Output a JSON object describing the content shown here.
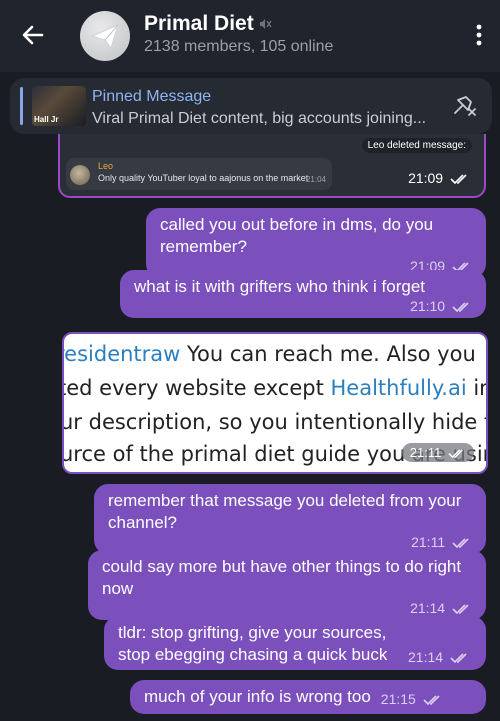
{
  "header": {
    "title": "Primal Diet",
    "subtitle": "2138 members, 105 online",
    "back_icon": "arrow-left-icon",
    "mute_icon": "mute-icon",
    "menu_icon": "more-vertical-icon"
  },
  "pinned": {
    "title": "Pinned Message",
    "preview": "Viral Primal Diet content, big accounts joining...",
    "thumb_label": "Hall Jr",
    "unpin_icon": "unpin-icon"
  },
  "reply_card": {
    "tag": "Leo deleted message:",
    "quote_name": "Leo",
    "quote_text": "Only quality YouTuber loyal to aajonus on the market",
    "quote_time": "21:04",
    "time": "21:09"
  },
  "messages": [
    {
      "text": "called you out before in dms, do you remember?",
      "time": "21:09"
    },
    {
      "text": "what is it with grifters who think i forget",
      "time": "21:10"
    },
    {
      "text": "remember that message you deleted from your channel?",
      "time": "21:11"
    },
    {
      "text": "could say more but have other things to do right now",
      "time": "21:14"
    },
    {
      "text": "tldr: stop grifting, give your sources, stop ebegging chasing a quick buck",
      "time": "21:14"
    },
    {
      "text": "much of your info is wrong too",
      "time": "21:15"
    }
  ],
  "screenshot_msg": {
    "line1_a": "residentraw",
    "line1_b": " You can reach me. Also you",
    "line2_a": "ted every website except ",
    "line2_link": "Healthfully.ai",
    "line2_b": " in",
    "line3": "ur description, so you intentionally hide th",
    "line4": "urce of the primal diet guide you are using",
    "time": "21:11"
  },
  "colors": {
    "bubble": "#7b4fbc",
    "background": "#191c22",
    "header": "#20242c",
    "pinned_accent": "#8db4f0"
  }
}
